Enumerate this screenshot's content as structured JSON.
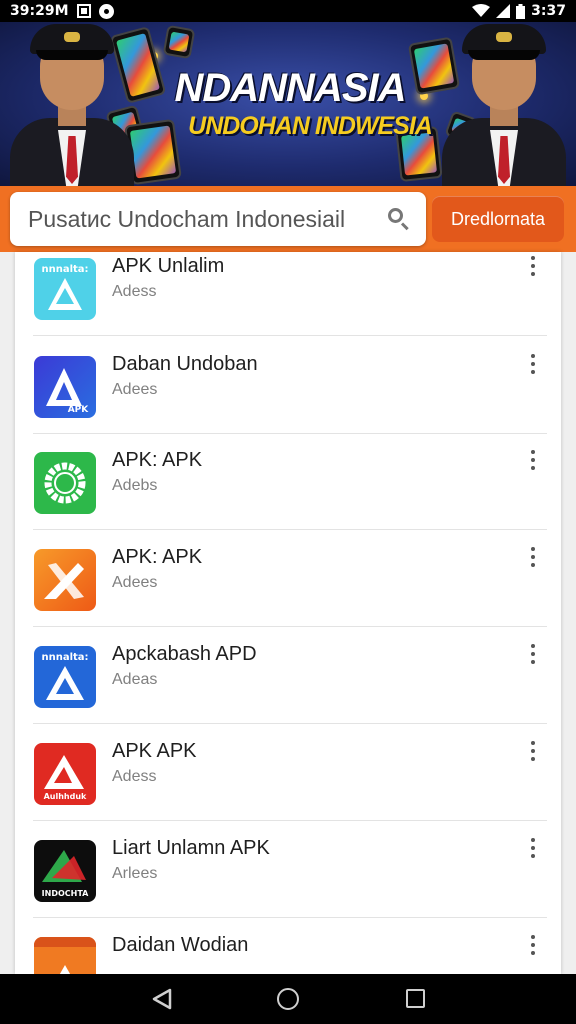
{
  "status_bar": {
    "time_left": "39:29M",
    "time_right": "3:37"
  },
  "banner": {
    "title": "NDANNASIA",
    "subtitle": "UNDOHAN INDWESIA"
  },
  "search": {
    "value": "Pusatиc Undocham Indonesiail",
    "button_label": "Dredlornata"
  },
  "app_list": [
    {
      "name": "APK Unlalim",
      "subtitle": "Adess",
      "icon": "apk-logo-icon-lightblue",
      "icon_text": "nnnalta:",
      "color": "#4fd1e8"
    },
    {
      "name": "Daban Undoban",
      "subtitle": "Adees",
      "icon": "apk-logo-icon-blue",
      "icon_text": "APK",
      "color": "#3a3fd8"
    },
    {
      "name": "APK: APK",
      "subtitle": "Adebs",
      "icon": "green-ring-icon",
      "icon_text": "",
      "color": "#2db84a"
    },
    {
      "name": "APK: APK",
      "subtitle": "Adees",
      "icon": "apk-logo-icon-orange",
      "icon_text": "",
      "color": "#f57a1f"
    },
    {
      "name": "Apckabash APD",
      "subtitle": "Adeas",
      "icon": "apk-logo-icon-blue2",
      "icon_text": "nnnalta:",
      "color": "#2367d8"
    },
    {
      "name": "APK APK",
      "subtitle": "Adess",
      "icon": "apk-logo-icon-red",
      "icon_text": "Aulhhduk",
      "color": "#e02a22"
    },
    {
      "name": "Liart Unlamn APK",
      "subtitle": "Arlees",
      "icon": "apk-logo-icon-black",
      "icon_text": "INDOCHTA",
      "color": "#0d0d0d"
    },
    {
      "name": "Daidan Wodian",
      "subtitle": "",
      "icon": "apk-logo-icon-orange2",
      "icon_text": "",
      "color": "#f07a22"
    }
  ]
}
